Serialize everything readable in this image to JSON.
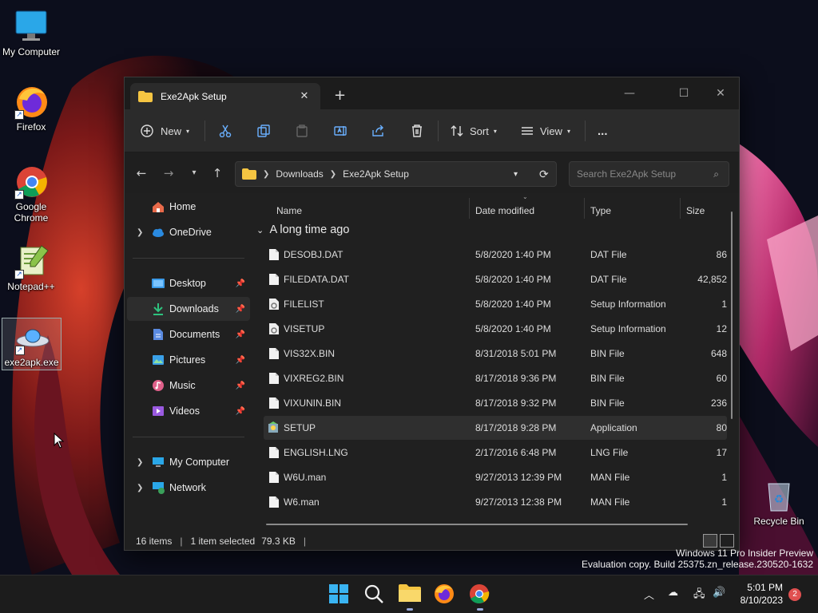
{
  "desktop": {
    "icons": [
      {
        "label": "My Computer",
        "icon": "monitor-icon"
      },
      {
        "label": "Firefox",
        "icon": "firefox-icon"
      },
      {
        "label": "Google Chrome",
        "icon": "chrome-icon"
      },
      {
        "label": "Notepad++",
        "icon": "notepadpp-icon"
      },
      {
        "label": "exe2apk.exe",
        "icon": "exe2apk-icon"
      },
      {
        "label": "Recycle Bin",
        "icon": "recycle-bin-icon"
      }
    ]
  },
  "window": {
    "tab_title": "Exe2Apk Setup",
    "toolbar": {
      "new_label": "New",
      "sort_label": "Sort",
      "view_label": "View",
      "more_label": "..."
    },
    "address": {
      "crumbs": [
        "Downloads",
        "Exe2Apk Setup"
      ]
    },
    "search_placeholder": "Search Exe2Apk Setup",
    "sidebar": {
      "items": [
        {
          "label": "Home",
          "icon": "home-icon"
        },
        {
          "label": "OneDrive",
          "icon": "cloud-icon"
        },
        {
          "label": "Desktop",
          "icon": "desktop-folder-icon"
        },
        {
          "label": "Downloads",
          "icon": "download-icon"
        },
        {
          "label": "Documents",
          "icon": "documents-icon"
        },
        {
          "label": "Pictures",
          "icon": "pictures-icon"
        },
        {
          "label": "Music",
          "icon": "music-icon"
        },
        {
          "label": "Videos",
          "icon": "videos-icon"
        },
        {
          "label": "My Computer",
          "icon": "monitor-icon"
        },
        {
          "label": "Network",
          "icon": "network-icon"
        }
      ]
    },
    "columns": {
      "name": "Name",
      "date": "Date modified",
      "type": "Type",
      "size": "Size"
    },
    "group_header": "A long time ago",
    "files": [
      {
        "name": "DESOBJ.DAT",
        "date": "5/8/2020 1:40 PM",
        "type": "DAT File",
        "size": "86"
      },
      {
        "name": "FILEDATA.DAT",
        "date": "5/8/2020 1:40 PM",
        "type": "DAT File",
        "size": "42,852"
      },
      {
        "name": "FILELIST",
        "date": "5/8/2020 1:40 PM",
        "type": "Setup Information",
        "size": "1"
      },
      {
        "name": "VISETUP",
        "date": "5/8/2020 1:40 PM",
        "type": "Setup Information",
        "size": "12"
      },
      {
        "name": "VIS32X.BIN",
        "date": "8/31/2018 5:01 PM",
        "type": "BIN File",
        "size": "648"
      },
      {
        "name": "VIXREG2.BIN",
        "date": "8/17/2018 9:36 PM",
        "type": "BIN File",
        "size": "60"
      },
      {
        "name": "VIXUNIN.BIN",
        "date": "8/17/2018 9:32 PM",
        "type": "BIN File",
        "size": "236"
      },
      {
        "name": "SETUP",
        "date": "8/17/2018 9:28 PM",
        "type": "Application",
        "size": "80"
      },
      {
        "name": "ENGLISH.LNG",
        "date": "2/17/2016 6:48 PM",
        "type": "LNG File",
        "size": "17"
      },
      {
        "name": "W6U.man",
        "date": "9/27/2013 12:39 PM",
        "type": "MAN File",
        "size": "1"
      },
      {
        "name": "W6.man",
        "date": "9/27/2013 12:38 PM",
        "type": "MAN File",
        "size": "1"
      }
    ],
    "status": {
      "item_count": "16 items",
      "selection": "1 item selected",
      "selection_size": "79.3 KB"
    }
  },
  "watermark": {
    "line1": "Windows 11 Pro Insider Preview",
    "line2": "Evaluation copy. Build 25375.zn_release.230520-1632"
  },
  "taskbar": {
    "time": "5:01 PM",
    "date": "8/10/2023",
    "notifications": "2"
  }
}
